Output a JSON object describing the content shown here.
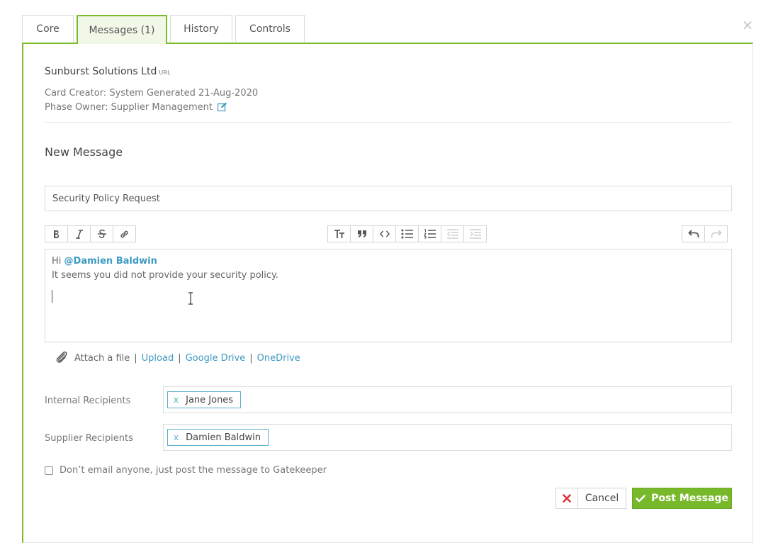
{
  "dialog": {
    "close_icon": "close-icon",
    "close_glyph": "×"
  },
  "tabs": [
    {
      "label": "Core"
    },
    {
      "label": "Messages (1)",
      "active": true
    },
    {
      "label": "History"
    },
    {
      "label": "Controls"
    }
  ],
  "card": {
    "company_name": "Sunburst Solutions Ltd",
    "url_label": "URL",
    "creator_line": "Card Creator: System Generated 21-Aug-2020",
    "owner_line": "Phase Owner: Supplier Management",
    "owner_edit_icon": "edit-icon"
  },
  "new_message": {
    "title": "New Message",
    "subject_value": "Security Policy Request",
    "toolbar": {
      "left": [
        "bold-icon",
        "italic-icon",
        "strikethrough-icon",
        "link-icon"
      ],
      "middle": [
        "heading-icon",
        "quote-icon",
        "code-icon",
        "bullet-list-icon",
        "numbered-list-icon",
        "outdent-icon",
        "indent-icon"
      ],
      "right": [
        "undo-icon",
        "redo-icon"
      ],
      "disabled": [
        "outdent-icon",
        "indent-icon",
        "redo-icon"
      ]
    },
    "body": {
      "greeting": "Hi",
      "mention": "@Damien Baldwin",
      "line2": "It seems you did not provide your security policy."
    },
    "attach": {
      "icon": "paperclip-icon",
      "label": "Attach a file",
      "separator": "|",
      "upload": "Upload",
      "google_drive": "Google Drive",
      "onedrive": "OneDrive"
    },
    "internal_recipients": {
      "label": "Internal Recipients",
      "tokens": [
        {
          "name": "Jane Jones",
          "remove": "x"
        }
      ]
    },
    "supplier_recipients": {
      "label": "Supplier Recipients",
      "tokens": [
        {
          "name": "Damien Baldwin",
          "remove": "x"
        }
      ]
    },
    "no_email_checkbox": {
      "label": "Don’t email anyone, just post the message to Gatekeeper",
      "checked": false
    },
    "buttons": {
      "cancel": "Cancel",
      "post": "Post Message"
    }
  },
  "colors": {
    "accent_green": "#7dbb2e",
    "post_button": "#78b92b",
    "link_blue": "#3d9ac2",
    "cancel_red": "#d9363e"
  }
}
